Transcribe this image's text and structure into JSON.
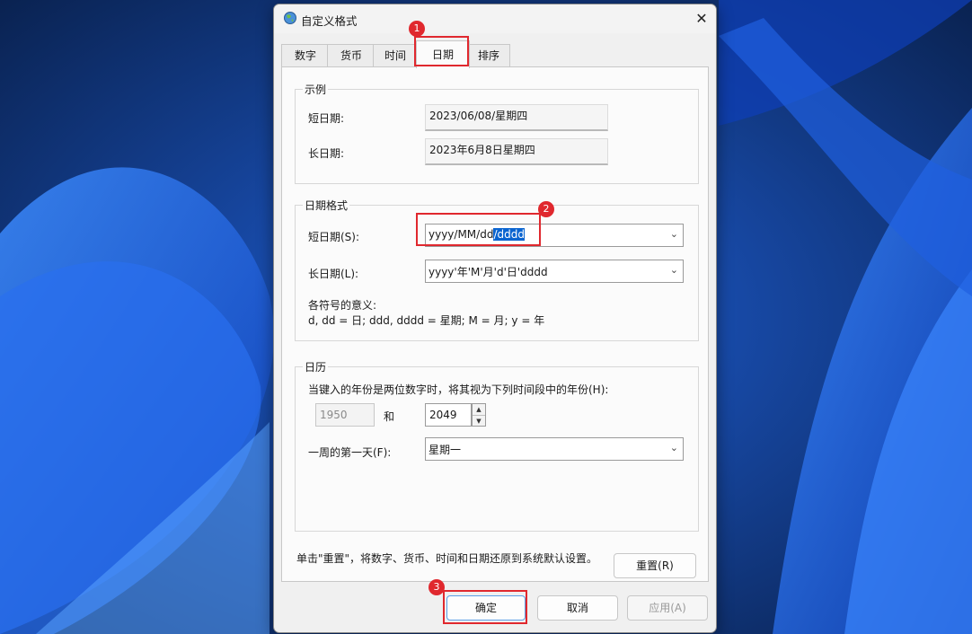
{
  "window": {
    "title": "自定义格式",
    "close_glyph": "✕"
  },
  "tabs": [
    {
      "label": "数字",
      "active": false
    },
    {
      "label": "货币",
      "active": false
    },
    {
      "label": "时间",
      "active": false
    },
    {
      "label": "日期",
      "active": true
    },
    {
      "label": "排序",
      "active": false
    }
  ],
  "example": {
    "group_title": "示例",
    "short_label": "短日期:",
    "short_value": "2023/06/08/星期四",
    "long_label": "长日期:",
    "long_value": "2023年6月8日星期四"
  },
  "date_format": {
    "group_title": "日期格式",
    "short_label": "短日期(S):",
    "short_value_plain": "yyyy/MM/dd",
    "short_value_selected": "/dddd",
    "long_label": "长日期(L):",
    "long_value": "yyyy'年'M'月'd'日'dddd",
    "legend_title": "各符号的意义:",
    "legend_text": "d, dd = 日; ddd, dddd = 星期; M = 月; y = 年"
  },
  "calendar": {
    "group_title": "日历",
    "twodigit_label": "当键入的年份是两位数字时，将其视为下列时间段中的年份(H):",
    "year_from": "1950",
    "and_label": "和",
    "year_to": "2049",
    "firstday_label": "一周的第一天(F):",
    "firstday_value": "星期一"
  },
  "reset": {
    "text": "单击\"重置\"，将数字、货币、时间和日期还原到系统默认设置。",
    "button_label": "重置(R)"
  },
  "footer": {
    "ok_label": "确定",
    "cancel_label": "取消",
    "apply_label": "应用(A)"
  },
  "annotations": {
    "badge1": "1",
    "badge2": "2",
    "badge3": "3",
    "color": "#e0282e"
  },
  "icons": {
    "dropdown": "chevron-down-icon",
    "spin_up": "▲",
    "spin_down": "▼"
  }
}
